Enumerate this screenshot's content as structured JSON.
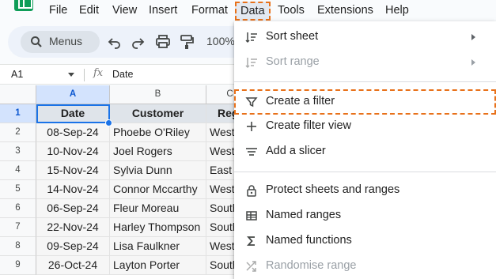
{
  "menubar": {
    "items": [
      "File",
      "Edit",
      "View",
      "Insert",
      "Format",
      "Data",
      "Tools",
      "Extensions",
      "Help"
    ]
  },
  "toolbar": {
    "search_label": "Menus",
    "zoom": "100%"
  },
  "formula_bar": {
    "cell_ref": "A1",
    "fx_label": "fx",
    "value": "Date"
  },
  "grid": {
    "columns": [
      "A",
      "B",
      "C"
    ],
    "rows": [
      "1",
      "2",
      "3",
      "4",
      "5",
      "6",
      "7",
      "8",
      "9"
    ],
    "headers": [
      "Date",
      "Customer",
      "Reg"
    ],
    "data": [
      [
        "08-Sep-24",
        "Phoebe O'Riley",
        "West"
      ],
      [
        "10-Nov-24",
        "Joel Rogers",
        "West"
      ],
      [
        "15-Nov-24",
        "Sylvia Dunn",
        "East"
      ],
      [
        "14-Nov-24",
        "Connor Mccarthy",
        "West"
      ],
      [
        "06-Sep-24",
        "Fleur Moreau",
        "South"
      ],
      [
        "22-Nov-24",
        "Harley Thompson",
        "South"
      ],
      [
        "09-Sep-24",
        "Lisa Faulkner",
        "West"
      ],
      [
        "26-Oct-24",
        "Layton Porter",
        "South"
      ]
    ]
  },
  "data_menu": {
    "items": [
      {
        "label": "Sort sheet",
        "icon": "sort-icon",
        "submenu": true,
        "disabled": false
      },
      {
        "label": "Sort range",
        "icon": "sort-icon",
        "submenu": true,
        "disabled": true
      },
      {
        "label": "Create a filter",
        "icon": "filter-icon",
        "submenu": false,
        "disabled": false,
        "highlighted": true
      },
      {
        "label": "Create filter view",
        "icon": "plus-icon",
        "submenu": false,
        "disabled": false
      },
      {
        "label": "Add a slicer",
        "icon": "slicer-icon",
        "submenu": false,
        "disabled": false
      },
      {
        "label": "Protect sheets and ranges",
        "icon": "lock-icon",
        "submenu": false,
        "disabled": false
      },
      {
        "label": "Named ranges",
        "icon": "table-icon",
        "submenu": false,
        "disabled": false
      },
      {
        "label": "Named functions",
        "icon": "sigma-icon",
        "submenu": false,
        "disabled": false
      },
      {
        "label": "Randomise range",
        "icon": "shuffle-icon",
        "submenu": false,
        "disabled": true
      }
    ]
  },
  "colors": {
    "accent": "#1a73e8",
    "highlight": "#e8711a",
    "sheets_green": "#0f9d58"
  }
}
